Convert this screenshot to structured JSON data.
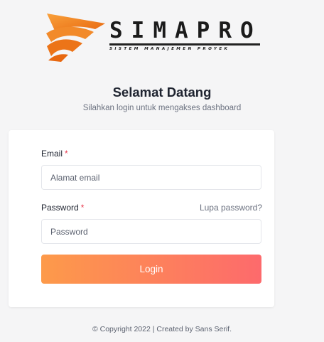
{
  "logo": {
    "wordmark": "SIMAPRO",
    "tagline": "SISTEM MANAJEMEN PROYEK"
  },
  "header": {
    "title": "Selamat Datang",
    "subtitle": "Silahkan login untuk mengakses dashboard"
  },
  "form": {
    "email_label": "Email",
    "email_placeholder": "Alamat email",
    "password_label": "Password",
    "password_placeholder": "Password",
    "forgot_link": "Lupa password?",
    "required_mark": "*",
    "login_button": "Login"
  },
  "footer": {
    "copyright": "© Copyright 2022 | Created by Sans Serif."
  },
  "colors": {
    "accent_start": "#fd9a4a",
    "accent_end": "#fd6a6c",
    "required": "#e8394d",
    "logo_orange": "#f07a1d"
  },
  "icons": [
    "simapro-logo-icon"
  ]
}
